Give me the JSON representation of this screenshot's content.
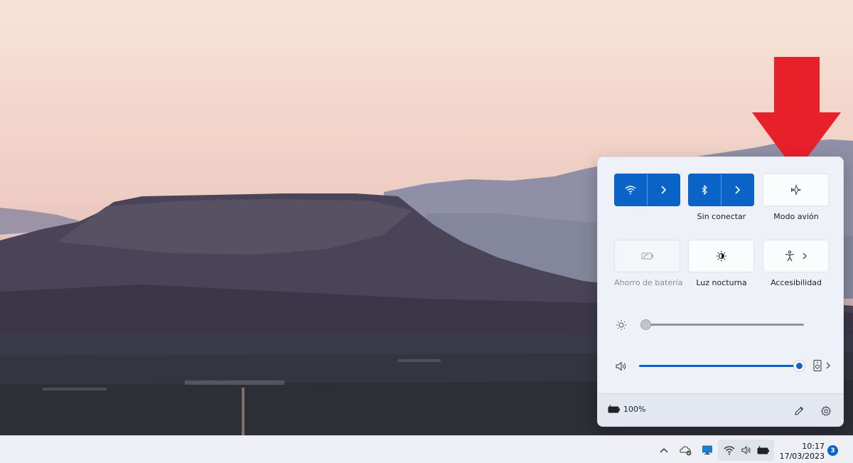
{
  "quick_settings": {
    "tiles": [
      {
        "id": "wifi",
        "label": "",
        "active": true,
        "icon": "wifi-icon",
        "has_chevron": true
      },
      {
        "id": "bluetooth",
        "label": "Sin conectar",
        "active": true,
        "icon": "bluetooth-icon",
        "has_chevron": true
      },
      {
        "id": "airplane",
        "label": "Modo avión",
        "active": false,
        "icon": "airplane-icon"
      },
      {
        "id": "battery_saver",
        "label": "Ahorro de batería",
        "active": false,
        "disabled": true,
        "icon": "battery-saver-icon"
      },
      {
        "id": "night_light",
        "label": "Luz nocturna",
        "active": false,
        "icon": "night-light-icon"
      },
      {
        "id": "accessibility",
        "label": "Accesibilidad",
        "active": false,
        "icon": "accessibility-icon",
        "has_chevron": true
      }
    ],
    "brightness": {
      "value": 0,
      "icon": "brightness-icon"
    },
    "volume": {
      "value": 100,
      "icon": "speaker-icon",
      "output_icon": "speaker-device-icon"
    },
    "footer": {
      "battery_text": "100%",
      "battery_icon": "battery-charging-icon",
      "edit_icon": "pencil-icon",
      "settings_icon": "gear-icon"
    }
  },
  "taskbar": {
    "tray_icons": [
      "chevron-up-icon",
      "onedrive-sync-icon",
      "display-icon",
      "wifi-icon",
      "speaker-icon",
      "battery-charging-icon"
    ],
    "time": "10:17",
    "date": "17/03/2023",
    "notification_count": "3"
  },
  "colors": {
    "accent": "#0a64c8",
    "arrow": "#e8202a",
    "panel_bg": "#eef1f8",
    "taskbar_bg": "#eef0f6"
  }
}
